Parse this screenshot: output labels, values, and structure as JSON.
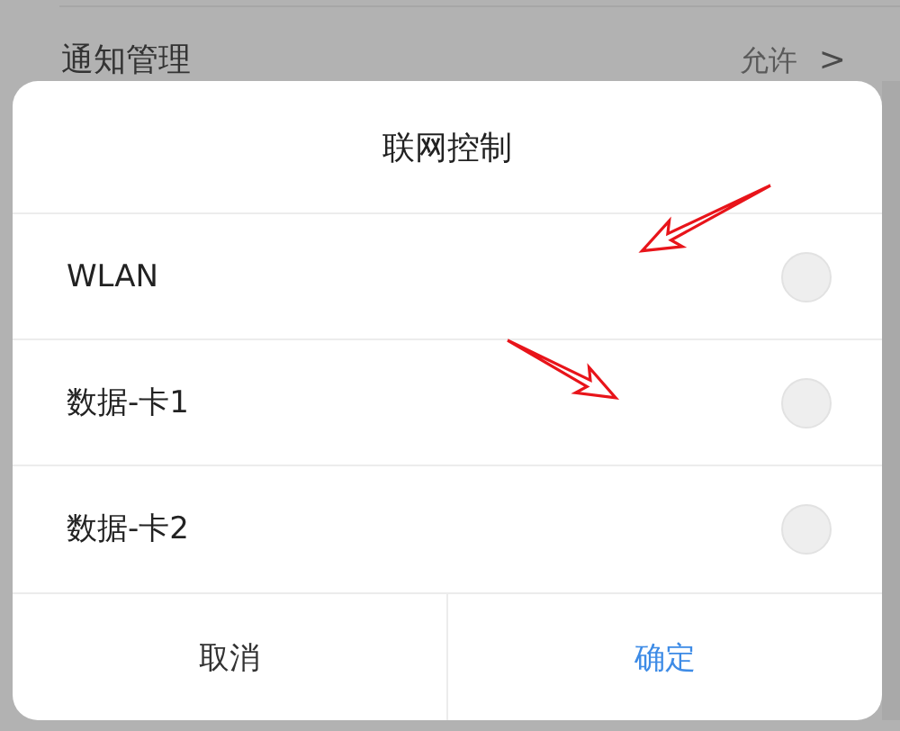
{
  "background": {
    "row_label": "通知管理",
    "row_value": "允许",
    "row_chevron": ">"
  },
  "dialog": {
    "title": "联网控制",
    "options": [
      {
        "label": "WLAN",
        "selected": false
      },
      {
        "label": "数据-卡1",
        "selected": false
      },
      {
        "label": "数据-卡2",
        "selected": false
      }
    ],
    "buttons": [
      {
        "label": "取消",
        "kind": "cancel"
      },
      {
        "label": "确定",
        "kind": "primary"
      }
    ]
  },
  "annotations": [
    {
      "kind": "arrow"
    },
    {
      "kind": "arrow"
    }
  ]
}
